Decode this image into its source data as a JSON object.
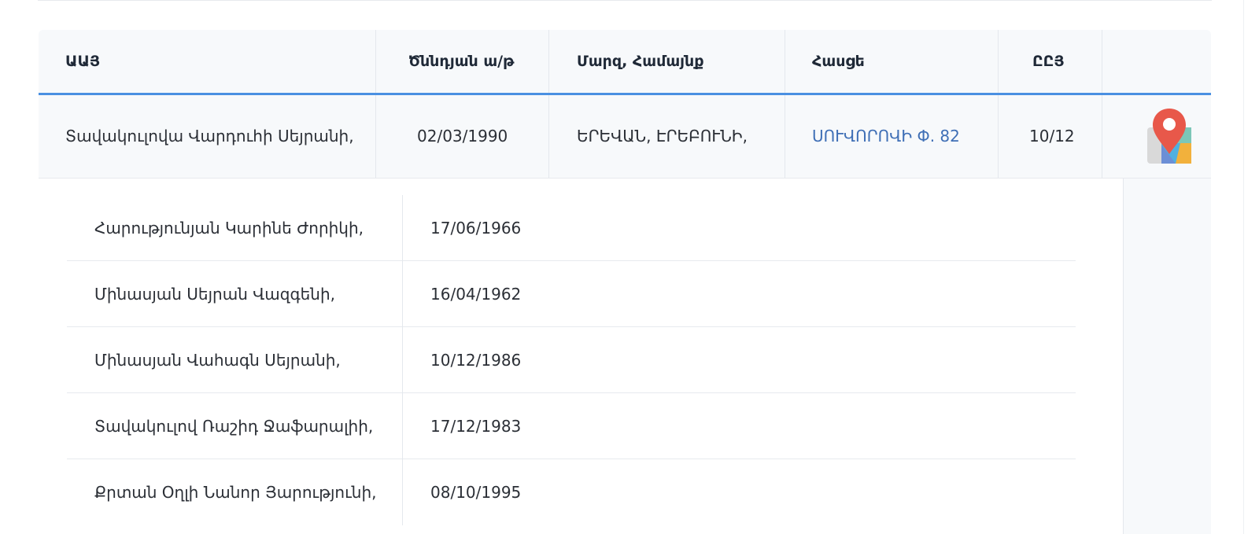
{
  "table": {
    "headers": {
      "name": "ԱԱՅ",
      "birth_date": "Ծննդյան ա/թ",
      "region": "Մարզ, Համայնք",
      "address": "Հասցե",
      "precinct": "ԸԸՅ"
    },
    "main_row": {
      "name": "Տավակուլովա Վարդուհի Սեյրանի,",
      "birth_date": "02/03/1990",
      "region": "ԵՐԵՎԱՆ, ԷՐԵԲՈՒՆԻ,",
      "address": "ՍՈՒՎՈՐՈՎԻ Փ. 82",
      "precinct": "10/12",
      "map_icon": "map-pin-icon"
    },
    "members": [
      {
        "name": "Հարությունյան Կարինե Ժորիկի,",
        "birth_date": "17/06/1966"
      },
      {
        "name": "Մինասյան Սեյրան Վազգենի,",
        "birth_date": "16/04/1962"
      },
      {
        "name": "Մինասյան Վահագն Սեյրանի,",
        "birth_date": "10/12/1986"
      },
      {
        "name": "Տավակուլով Ռաշիդ Ջաֆարալիի,",
        "birth_date": "17/12/1983"
      },
      {
        "name": "Քրտան Օղլի Նանոր Յարությունի,",
        "birth_date": "08/10/1995"
      }
    ]
  },
  "colors": {
    "accent": "#4a90e2",
    "link": "#3f6fb6",
    "header_bg": "#f7f9fb",
    "pin": "#e8584a"
  }
}
